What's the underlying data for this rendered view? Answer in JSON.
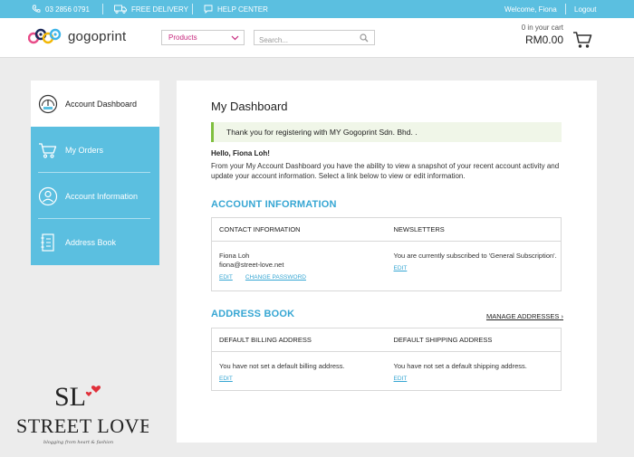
{
  "topbar": {
    "phone": "03 2856 0791",
    "delivery": "FREE DELIVERY",
    "help": "HELP CENTER",
    "welcome": "Welcome, Fiona",
    "logout": "Logout"
  },
  "header": {
    "logo_text": "gogoprint",
    "products_label": "Products",
    "search_placeholder": "Search...",
    "cart_count": "0 in your cart",
    "cart_total": "RM0.00"
  },
  "sidebar": {
    "items": [
      {
        "label": "Account Dashboard",
        "icon": "gauge-icon"
      },
      {
        "label": "My Orders",
        "icon": "cart-icon"
      },
      {
        "label": "Account Information",
        "icon": "user-icon"
      },
      {
        "label": "Address Book",
        "icon": "address-book-icon"
      }
    ]
  },
  "main": {
    "title": "My Dashboard",
    "notice": "Thank you for registering with MY Gogoprint Sdn. Bhd. .",
    "greeting": "Hello, Fiona Loh!",
    "intro": "From your My Account Dashboard you have the ability to view a snapshot of your recent account activity and update your account information. Select a link below to view or edit information.",
    "account_info": {
      "heading": "ACCOUNT INFORMATION",
      "contact_header": "CONTACT INFORMATION",
      "newsletters_header": "NEWSLETTERS",
      "contact_name": "Fiona Loh",
      "contact_email": "fiona@street-love.net",
      "edit_label": "EDIT",
      "change_password_label": "CHANGE PASSWORD",
      "newsletter_text": "You are currently subscribed to 'General Subscription'.",
      "newsletter_edit_label": "EDIT"
    },
    "address_book": {
      "heading": "ADDRESS BOOK",
      "manage_label": "MANAGE ADDRESSES",
      "billing_header": "DEFAULT BILLING ADDRESS",
      "shipping_header": "DEFAULT SHIPPING ADDRESS",
      "billing_text": "You have not set a default billing address.",
      "shipping_text": "You have not set a default shipping address.",
      "billing_edit_label": "EDIT",
      "shipping_edit_label": "EDIT"
    }
  },
  "watermark": {
    "monogram": "SL",
    "brand": "STREET LOVE",
    "tagline": "blogging from heart & fashion"
  },
  "colors": {
    "accent": "#5bbfe0",
    "heading_blue": "#36a6d3",
    "product_pink": "#c6267c",
    "notice_green": "#7fbf3f"
  }
}
